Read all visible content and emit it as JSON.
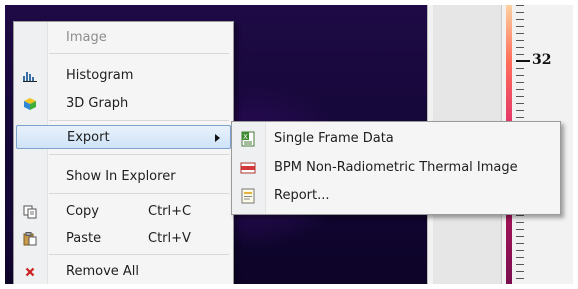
{
  "context_menu": {
    "items": [
      {
        "label": "Image",
        "icon": "",
        "disabled": true
      },
      {
        "label": "Histogram",
        "icon": "histogram-icon"
      },
      {
        "label": "3D Graph",
        "icon": "3d-graph-icon"
      },
      {
        "label": "Export",
        "icon": "",
        "has_submenu": true,
        "highlighted": true
      },
      {
        "label": "Show In Explorer",
        "icon": ""
      },
      {
        "label": "Copy",
        "shortcut": "Ctrl+C",
        "icon": "copy-icon"
      },
      {
        "label": "Paste",
        "shortcut": "Ctrl+V",
        "icon": "paste-icon"
      },
      {
        "label": "Remove All",
        "icon": "remove-icon"
      }
    ]
  },
  "export_submenu": {
    "items": [
      {
        "label": "Single Frame Data",
        "icon": "spreadsheet-icon"
      },
      {
        "label": "BPM Non-Radiometric Thermal Image",
        "icon": "image-file-icon"
      },
      {
        "label": "Report...",
        "icon": "report-icon"
      }
    ]
  },
  "scale": {
    "label": "32"
  },
  "colors": {
    "highlight_border": "#7da2ce",
    "menu_bg": "#f5f5f5",
    "thermal_bg": "#1a0840",
    "remove_icon": "#cc1f1f"
  }
}
